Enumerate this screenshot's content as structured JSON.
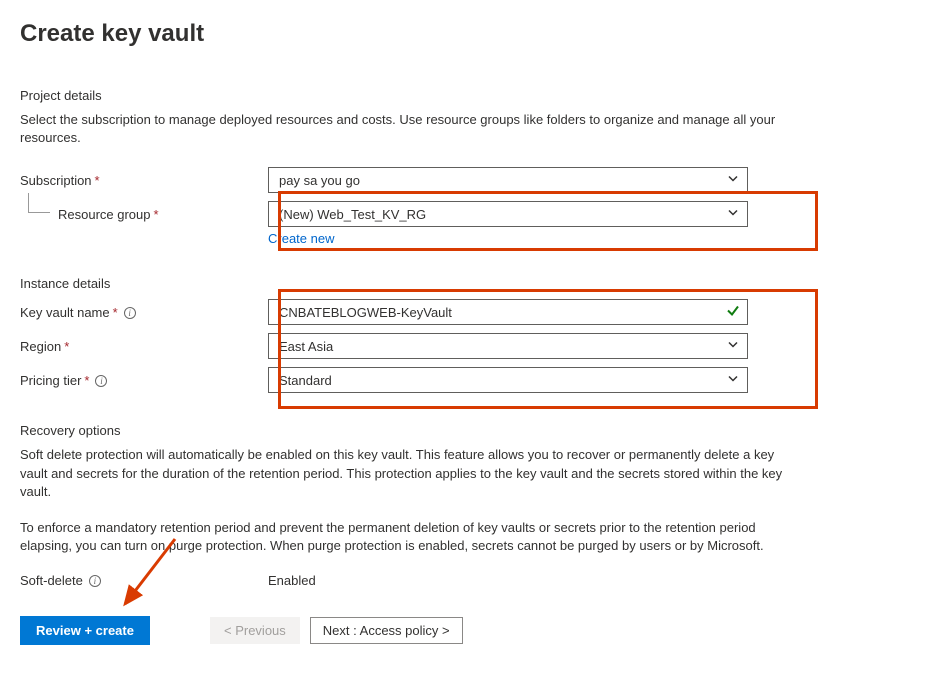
{
  "page_title": "Create key vault",
  "project_details": {
    "heading": "Project details",
    "description": "Select the subscription to manage deployed resources and costs. Use resource groups like folders to organize and manage all your resources.",
    "subscription": {
      "label": "Subscription",
      "value": "pay sa you go"
    },
    "resource_group": {
      "label": "Resource group",
      "value": "(New) Web_Test_KV_RG",
      "create_new": "Create new"
    }
  },
  "instance_details": {
    "heading": "Instance details",
    "key_vault_name": {
      "label": "Key vault name",
      "value": "CNBATEBLOGWEB-KeyVault"
    },
    "region": {
      "label": "Region",
      "value": "East Asia"
    },
    "pricing_tier": {
      "label": "Pricing tier",
      "value": "Standard"
    }
  },
  "recovery_options": {
    "heading": "Recovery options",
    "para1": "Soft delete protection will automatically be enabled on this key vault. This feature allows you to recover or permanently delete a key vault and secrets for the duration of the retention period. This protection applies to the key vault and the secrets stored within the key vault.",
    "para2": "To enforce a mandatory retention period and prevent the permanent deletion of key vaults or secrets prior to the retention period elapsing, you can turn on purge protection. When purge protection is enabled, secrets cannot be purged by users or by Microsoft.",
    "soft_delete": {
      "label": "Soft-delete",
      "value": "Enabled"
    }
  },
  "buttons": {
    "review_create": "Review + create",
    "previous": "< Previous",
    "next": "Next : Access policy >"
  }
}
